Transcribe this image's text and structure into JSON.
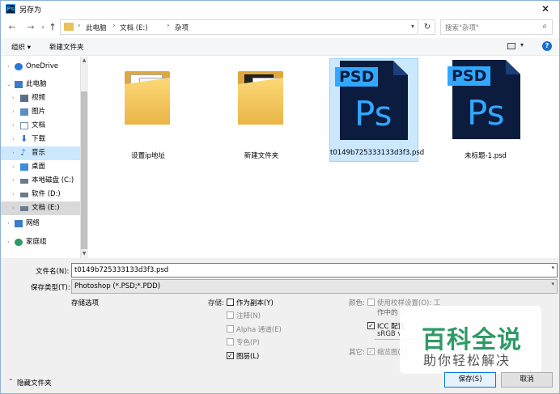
{
  "window": {
    "title": "另存为",
    "app_icon_text": "Ps",
    "close_glyph": "✕"
  },
  "nav": {
    "back_glyph": "←",
    "forward_glyph": "→",
    "up_glyph": "↑",
    "breadcrumbs": [
      "此电脑",
      "文档 (E:)",
      "杂项"
    ],
    "separator": "›",
    "refresh_glyph": "↻",
    "search_placeholder": "搜索\"杂项\"",
    "search_icon_glyph": "⌕"
  },
  "toolbar": {
    "organize": "组织 ▾",
    "new_folder": "新建文件夹",
    "view_drop": "▾",
    "help": "?"
  },
  "sidebar": {
    "items": [
      {
        "label": "OneDrive",
        "icon": "onedrive-icon",
        "color": "#2b79d4"
      },
      {
        "label": "此电脑",
        "icon": "computer-icon",
        "color": "#3d7cc9"
      },
      {
        "label": "视频",
        "icon": "video-icon",
        "color": "#5b6f86"
      },
      {
        "label": "图片",
        "icon": "pictures-icon",
        "color": "#5b8fc4"
      },
      {
        "label": "文档",
        "icon": "documents-icon",
        "color": "#7a8fa6"
      },
      {
        "label": "下载",
        "icon": "download-icon",
        "color": "#2f74c8"
      },
      {
        "label": "音乐",
        "icon": "music-icon",
        "color": "#2f74c8"
      },
      {
        "label": "桌面",
        "icon": "desktop-icon",
        "color": "#3d8be0"
      },
      {
        "label": "本地磁盘 (C:)",
        "icon": "drive-c-icon",
        "color": "#6a7b8c"
      },
      {
        "label": "软件 (D:)",
        "icon": "drive-d-icon",
        "color": "#6a7b8c"
      },
      {
        "label": "文档 (E:)",
        "icon": "drive-e-icon",
        "color": "#6a7b8c"
      },
      {
        "label": "网络",
        "icon": "network-icon",
        "color": "#3d7cc9"
      },
      {
        "label": "家庭组",
        "icon": "homegroup-icon",
        "color": "#2e9a66"
      }
    ],
    "chevron_collapsed": "›",
    "chevron_expanded": "⌄"
  },
  "files": [
    {
      "name": "设置ip地址",
      "type": "folder"
    },
    {
      "name": "新建文件夹",
      "type": "folder"
    },
    {
      "name": "t0149b725333133d3f3.psd",
      "type": "psd"
    },
    {
      "name": "未标题-1.psd",
      "type": "psd"
    }
  ],
  "psd_icon": {
    "tag": "PSD",
    "mark": "Ps"
  },
  "form": {
    "filename_label": "文件名(N):",
    "filename_value": "t0149b725333133d3f3.psd",
    "filetype_label": "保存类型(T):",
    "filetype_value": "Photoshop (*.PSD;*.PDD)",
    "dropdown_glyph": "▾"
  },
  "save_options": {
    "title": "存储选项",
    "store_label": "存储:",
    "store_items": [
      {
        "label": "作为副本(Y)",
        "checked": false,
        "enabled": true
      },
      {
        "label": "注释(N)",
        "checked": false,
        "enabled": false
      },
      {
        "label": "Alpha 通道(E)",
        "checked": false,
        "enabled": false
      },
      {
        "label": "专色(P)",
        "checked": false,
        "enabled": false
      },
      {
        "label": "图层(L)",
        "checked": true,
        "enabled": true
      }
    ],
    "color_label": "颜色:",
    "color_items": [
      {
        "label": "使用校样设置(O): 工",
        "checked": false,
        "enabled": false
      },
      {
        "label": "ICC 配置",
        "checked": true,
        "enabled": true
      }
    ],
    "color_subtext_1": "作中的 C",
    "color_subtext_2": "sRGB v",
    "other_label": "其它:",
    "other_items": [
      {
        "label": "缩览图(T)",
        "checked": true,
        "enabled": false
      }
    ],
    "check_glyph": "✓"
  },
  "watermark": {
    "top": "百科全说",
    "bottom": "助你轻松解决"
  },
  "footer": {
    "hide_folders": "隐藏文件夹",
    "hide_chevron": "⌃",
    "save": "保存(S)",
    "cancel": "取消"
  }
}
